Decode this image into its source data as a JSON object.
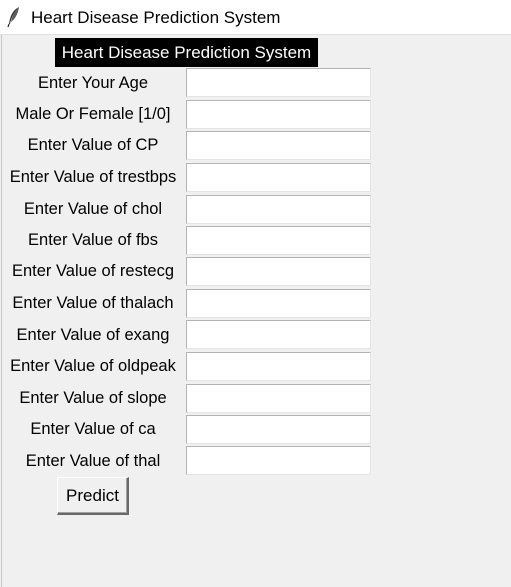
{
  "window": {
    "title": "Heart Disease Prediction System",
    "icon": "feather-icon"
  },
  "heading": "Heart Disease Prediction System",
  "fields": [
    {
      "label": "Enter Your Age",
      "value": ""
    },
    {
      "label": "Male Or Female [1/0]",
      "value": ""
    },
    {
      "label": "Enter Value of CP",
      "value": ""
    },
    {
      "label": "Enter Value of trestbps",
      "value": ""
    },
    {
      "label": "Enter Value of chol",
      "value": ""
    },
    {
      "label": "Enter Value of fbs",
      "value": ""
    },
    {
      "label": "Enter Value of restecg",
      "value": ""
    },
    {
      "label": "Enter Value of thalach",
      "value": ""
    },
    {
      "label": "Enter Value of exang",
      "value": ""
    },
    {
      "label": "Enter Value of oldpeak",
      "value": ""
    },
    {
      "label": "Enter Value of slope",
      "value": ""
    },
    {
      "label": "Enter Value of ca",
      "value": ""
    },
    {
      "label": "Enter Value of thal",
      "value": ""
    }
  ],
  "predict_button": "Predict"
}
